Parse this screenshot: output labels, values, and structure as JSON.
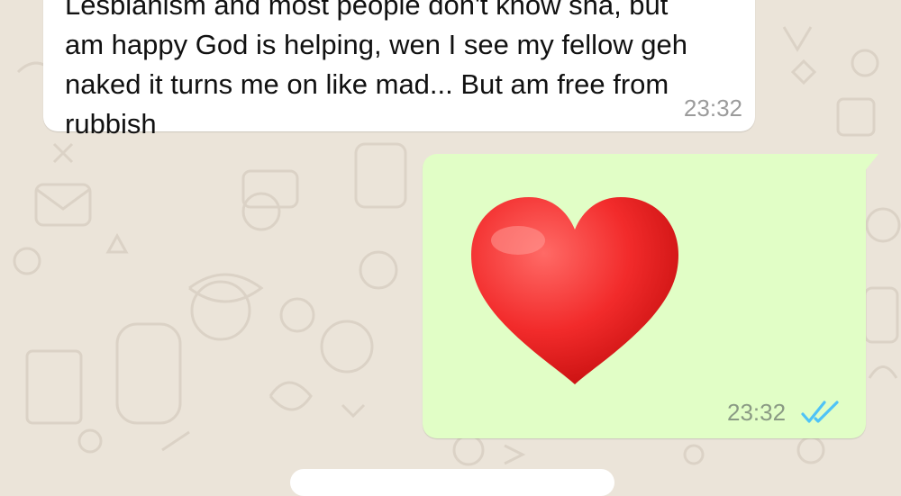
{
  "chat": {
    "incoming": {
      "text": "Lesbianism and most people don't know sha, but\nam happy God is helping, wen I see my fellow geh\nnaked it turns me on like mad... But am free from\nrubbish",
      "time": "23:32"
    },
    "outgoing": {
      "emoji_icon": "red-heart-icon",
      "time": "23:32",
      "status_icon": "double-check-read-icon",
      "status_color": "#4fc3f7"
    }
  },
  "colors": {
    "wallpaper": "#ebe4d9",
    "incoming_bubble": "#ffffff",
    "outgoing_bubble": "#e1fec6"
  }
}
